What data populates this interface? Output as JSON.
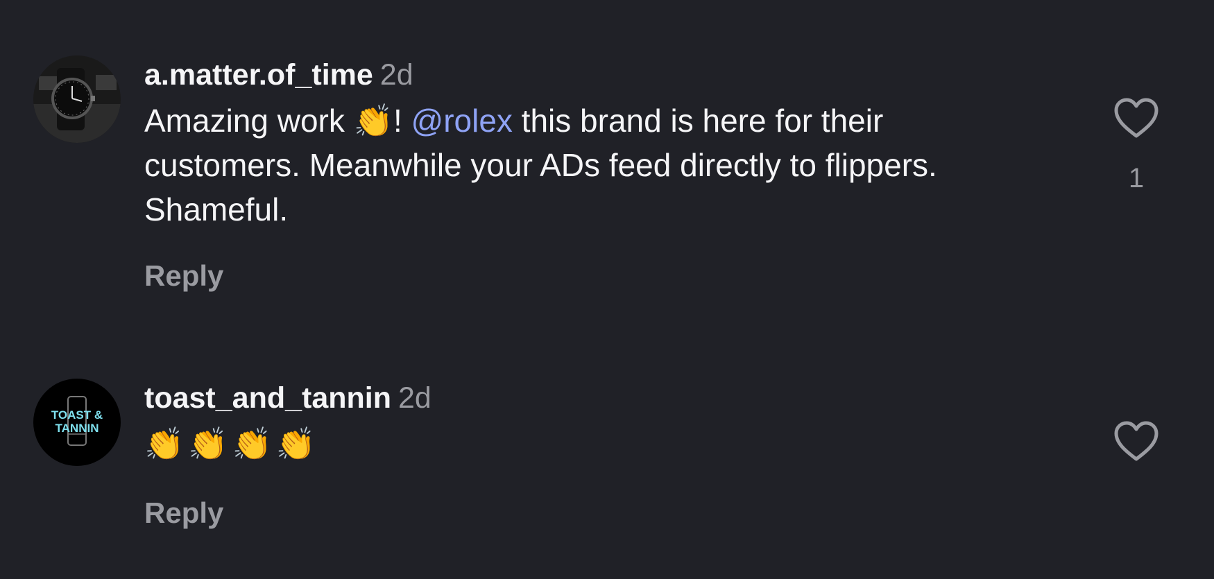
{
  "comments": [
    {
      "username": "a.matter.of_time",
      "time": "2d",
      "text_before": "Amazing work ",
      "emoji": "👏",
      "text_after_emoji": "! ",
      "mention": "@rolex",
      "text_after_mention": " this brand is here for their customers. Meanwhile your ADs feed directly to flippers. Shameful.",
      "reply_label": "Reply",
      "like_count": "1",
      "avatar_icon": "watch-avatar-icon"
    },
    {
      "username": "toast_and_tannin",
      "time": "2d",
      "emojis": "👏👏👏👏",
      "reply_label": "Reply",
      "avatar_icon": "toast-and-tannin-logo",
      "avatar_logo_line1": "TOAST &",
      "avatar_logo_line2": "TANNIN"
    }
  ],
  "colors": {
    "background": "#202127",
    "text": "#f5f5f7",
    "secondary": "#9a9ba1",
    "mention": "#8fa3f5"
  }
}
